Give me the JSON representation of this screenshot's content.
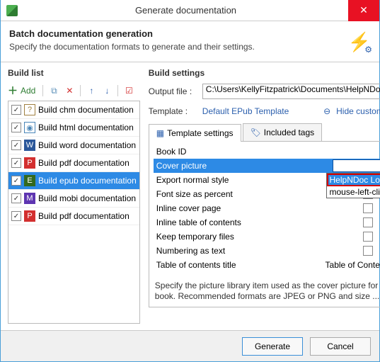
{
  "window": {
    "title": "Generate documentation"
  },
  "header": {
    "title": "Batch documentation generation",
    "subtitle": "Specify the documentation formats to generate and their settings."
  },
  "buildList": {
    "title": "Build list",
    "addLabel": "Add",
    "items": [
      {
        "label": "Build chm documentation",
        "checked": true,
        "icon": "chm"
      },
      {
        "label": "Build html documentation",
        "checked": true,
        "icon": "html"
      },
      {
        "label": "Build word documentation",
        "checked": true,
        "icon": "word"
      },
      {
        "label": "Build pdf documentation",
        "checked": true,
        "icon": "pdf"
      },
      {
        "label": "Build epub documentation",
        "checked": true,
        "icon": "epub",
        "selected": true
      },
      {
        "label": "Build mobi documentation",
        "checked": true,
        "icon": "mobi"
      },
      {
        "label": "Build pdf documentation",
        "checked": true,
        "icon": "pdf"
      }
    ]
  },
  "buildSettings": {
    "title": "Build settings",
    "outputLabel": "Output file :",
    "outputPath": "C:\\Users\\KellyFitzpatrick\\Documents\\HelpNDoc",
    "templateLabel": "Template :",
    "templateValue": "Default EPub Template",
    "hideCustomization": "Hide customization",
    "tabs": {
      "templateSettings": "Template settings",
      "includedTags": "Included tags"
    },
    "props": [
      {
        "label": "Book ID",
        "value": ""
      },
      {
        "label": "Cover picture",
        "value": "",
        "selected": true,
        "dropdown": true
      },
      {
        "label": "Export normal style",
        "checkbox": true,
        "checked": false
      },
      {
        "label": "Font size as percent",
        "checkbox": true,
        "checked": false
      },
      {
        "label": "Inline cover page",
        "checkbox": true,
        "checked": false
      },
      {
        "label": "Inline table of contents",
        "checkbox": true,
        "checked": false
      },
      {
        "label": "Keep temporary files",
        "checkbox": true,
        "checked": false
      },
      {
        "label": "Numbering as text",
        "checkbox": true,
        "checked": false
      },
      {
        "label": "Table of contents title",
        "text": "Table of Contents"
      }
    ],
    "dropdownItems": [
      "HelpNDoc Logo",
      "mouse-left-click"
    ],
    "hint": "Specify the picture library item used as the cover picture for the book. Recommended formats are JPEG or PNG and size ..."
  },
  "footer": {
    "generate": "Generate",
    "cancel": "Cancel"
  }
}
